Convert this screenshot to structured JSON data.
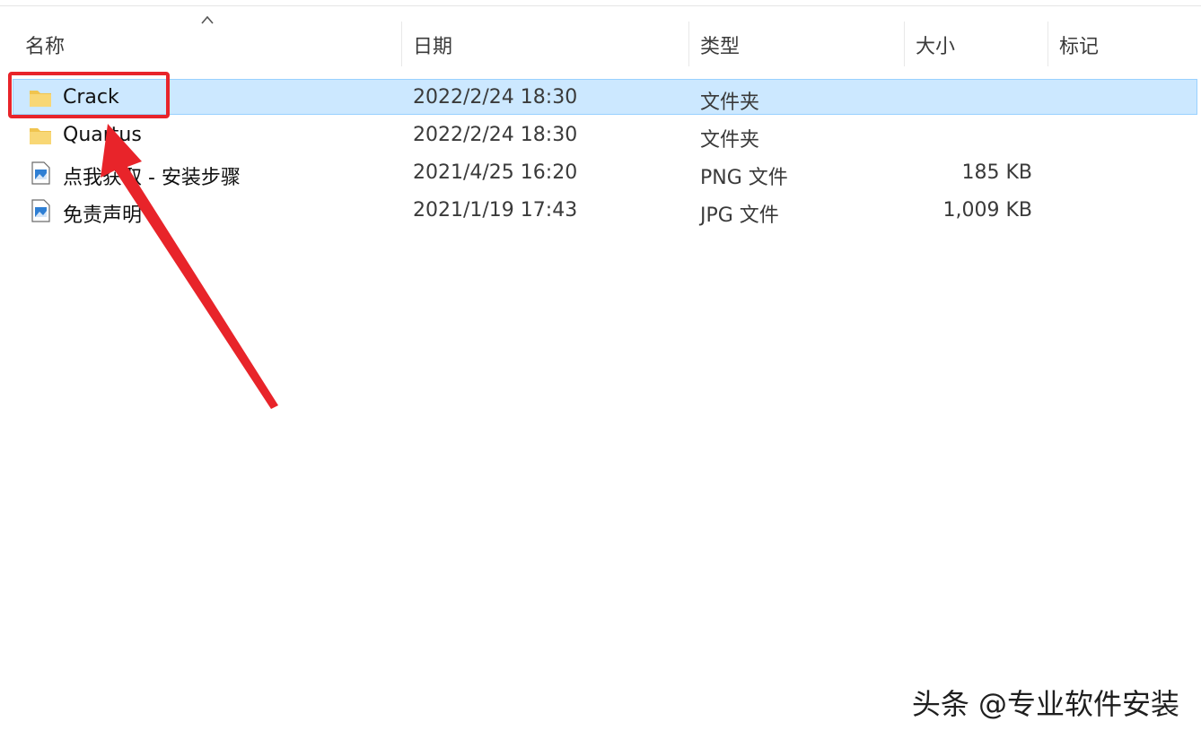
{
  "header": {
    "columns": [
      "名称",
      "日期",
      "类型",
      "大小",
      "标记"
    ],
    "sort_indicator": "up-caret-icon"
  },
  "files": [
    {
      "name": "Crack",
      "date": "2022/2/24 18:30",
      "type": "文件夹",
      "size": "",
      "icon": "folder-icon",
      "selected": true
    },
    {
      "name": "Quartus",
      "date": "2022/2/24 18:30",
      "type": "文件夹",
      "size": "",
      "icon": "folder-icon",
      "selected": false
    },
    {
      "name": "点我获取 - 安装步骤",
      "date": "2021/4/25 16:20",
      "type": "PNG 文件",
      "size": "185 KB",
      "icon": "image-file-icon",
      "selected": false
    },
    {
      "name": "免责声明",
      "date": "2021/1/19 17:43",
      "type": "JPG 文件",
      "size": "1,009 KB",
      "icon": "image-file-icon",
      "selected": false
    }
  ],
  "annotation": {
    "highlight_color": "#e8242a",
    "target": "Crack"
  },
  "watermark": "头条 @专业软件安装",
  "colors": {
    "selection_bg": "#cce8ff",
    "selection_border": "#99d1ff",
    "folder_yellow": "#f8d775"
  }
}
